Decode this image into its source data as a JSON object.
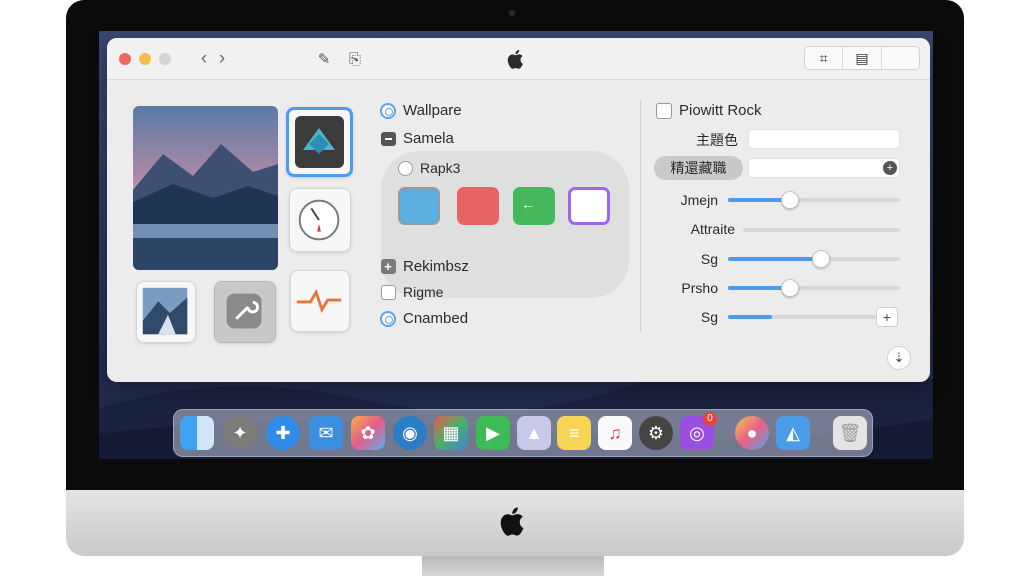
{
  "window": {
    "nav_back": "‹",
    "nav_forward": "›",
    "toolbar_left_icon": "✎",
    "toolbar_right_icon": "⎘",
    "segmented": [
      "⌗",
      "▤",
      ""
    ]
  },
  "middle": {
    "wallpaper_label": "Wallpare",
    "samela_label": "Samela",
    "rapk_label": "Rapk3",
    "rekimbsz_label": "Rekimbsz",
    "rigme_label": "Rigme",
    "cnambed_label": "Cnambed",
    "swatches": [
      {
        "name": "blue",
        "color": "#5aaee0"
      },
      {
        "name": "red",
        "color": "#e86464"
      },
      {
        "name": "green",
        "color": "#45b85c"
      },
      {
        "name": "white",
        "color": "#ffffff"
      }
    ]
  },
  "right": {
    "rock_label": "Piowitt Rock",
    "field_label": "主題色",
    "dropdown_label": "精還藏職",
    "sliders": [
      {
        "label": "Jmejn",
        "value": 0.36,
        "color": "#4d9bf0"
      },
      {
        "label": "Attraite",
        "value": 0.0,
        "color": "#4d9bf0"
      },
      {
        "label": "Sg",
        "value": 0.54,
        "color": "#4d9bf0"
      },
      {
        "label": "Prsho",
        "value": 0.36,
        "color": "#4d9bf0"
      },
      {
        "label": "Sg",
        "value": 0.3,
        "color": "#4d9bf0"
      }
    ],
    "plus_button": "+",
    "bottom_icon": "⇣"
  },
  "dock": {
    "badge_count": "0"
  }
}
